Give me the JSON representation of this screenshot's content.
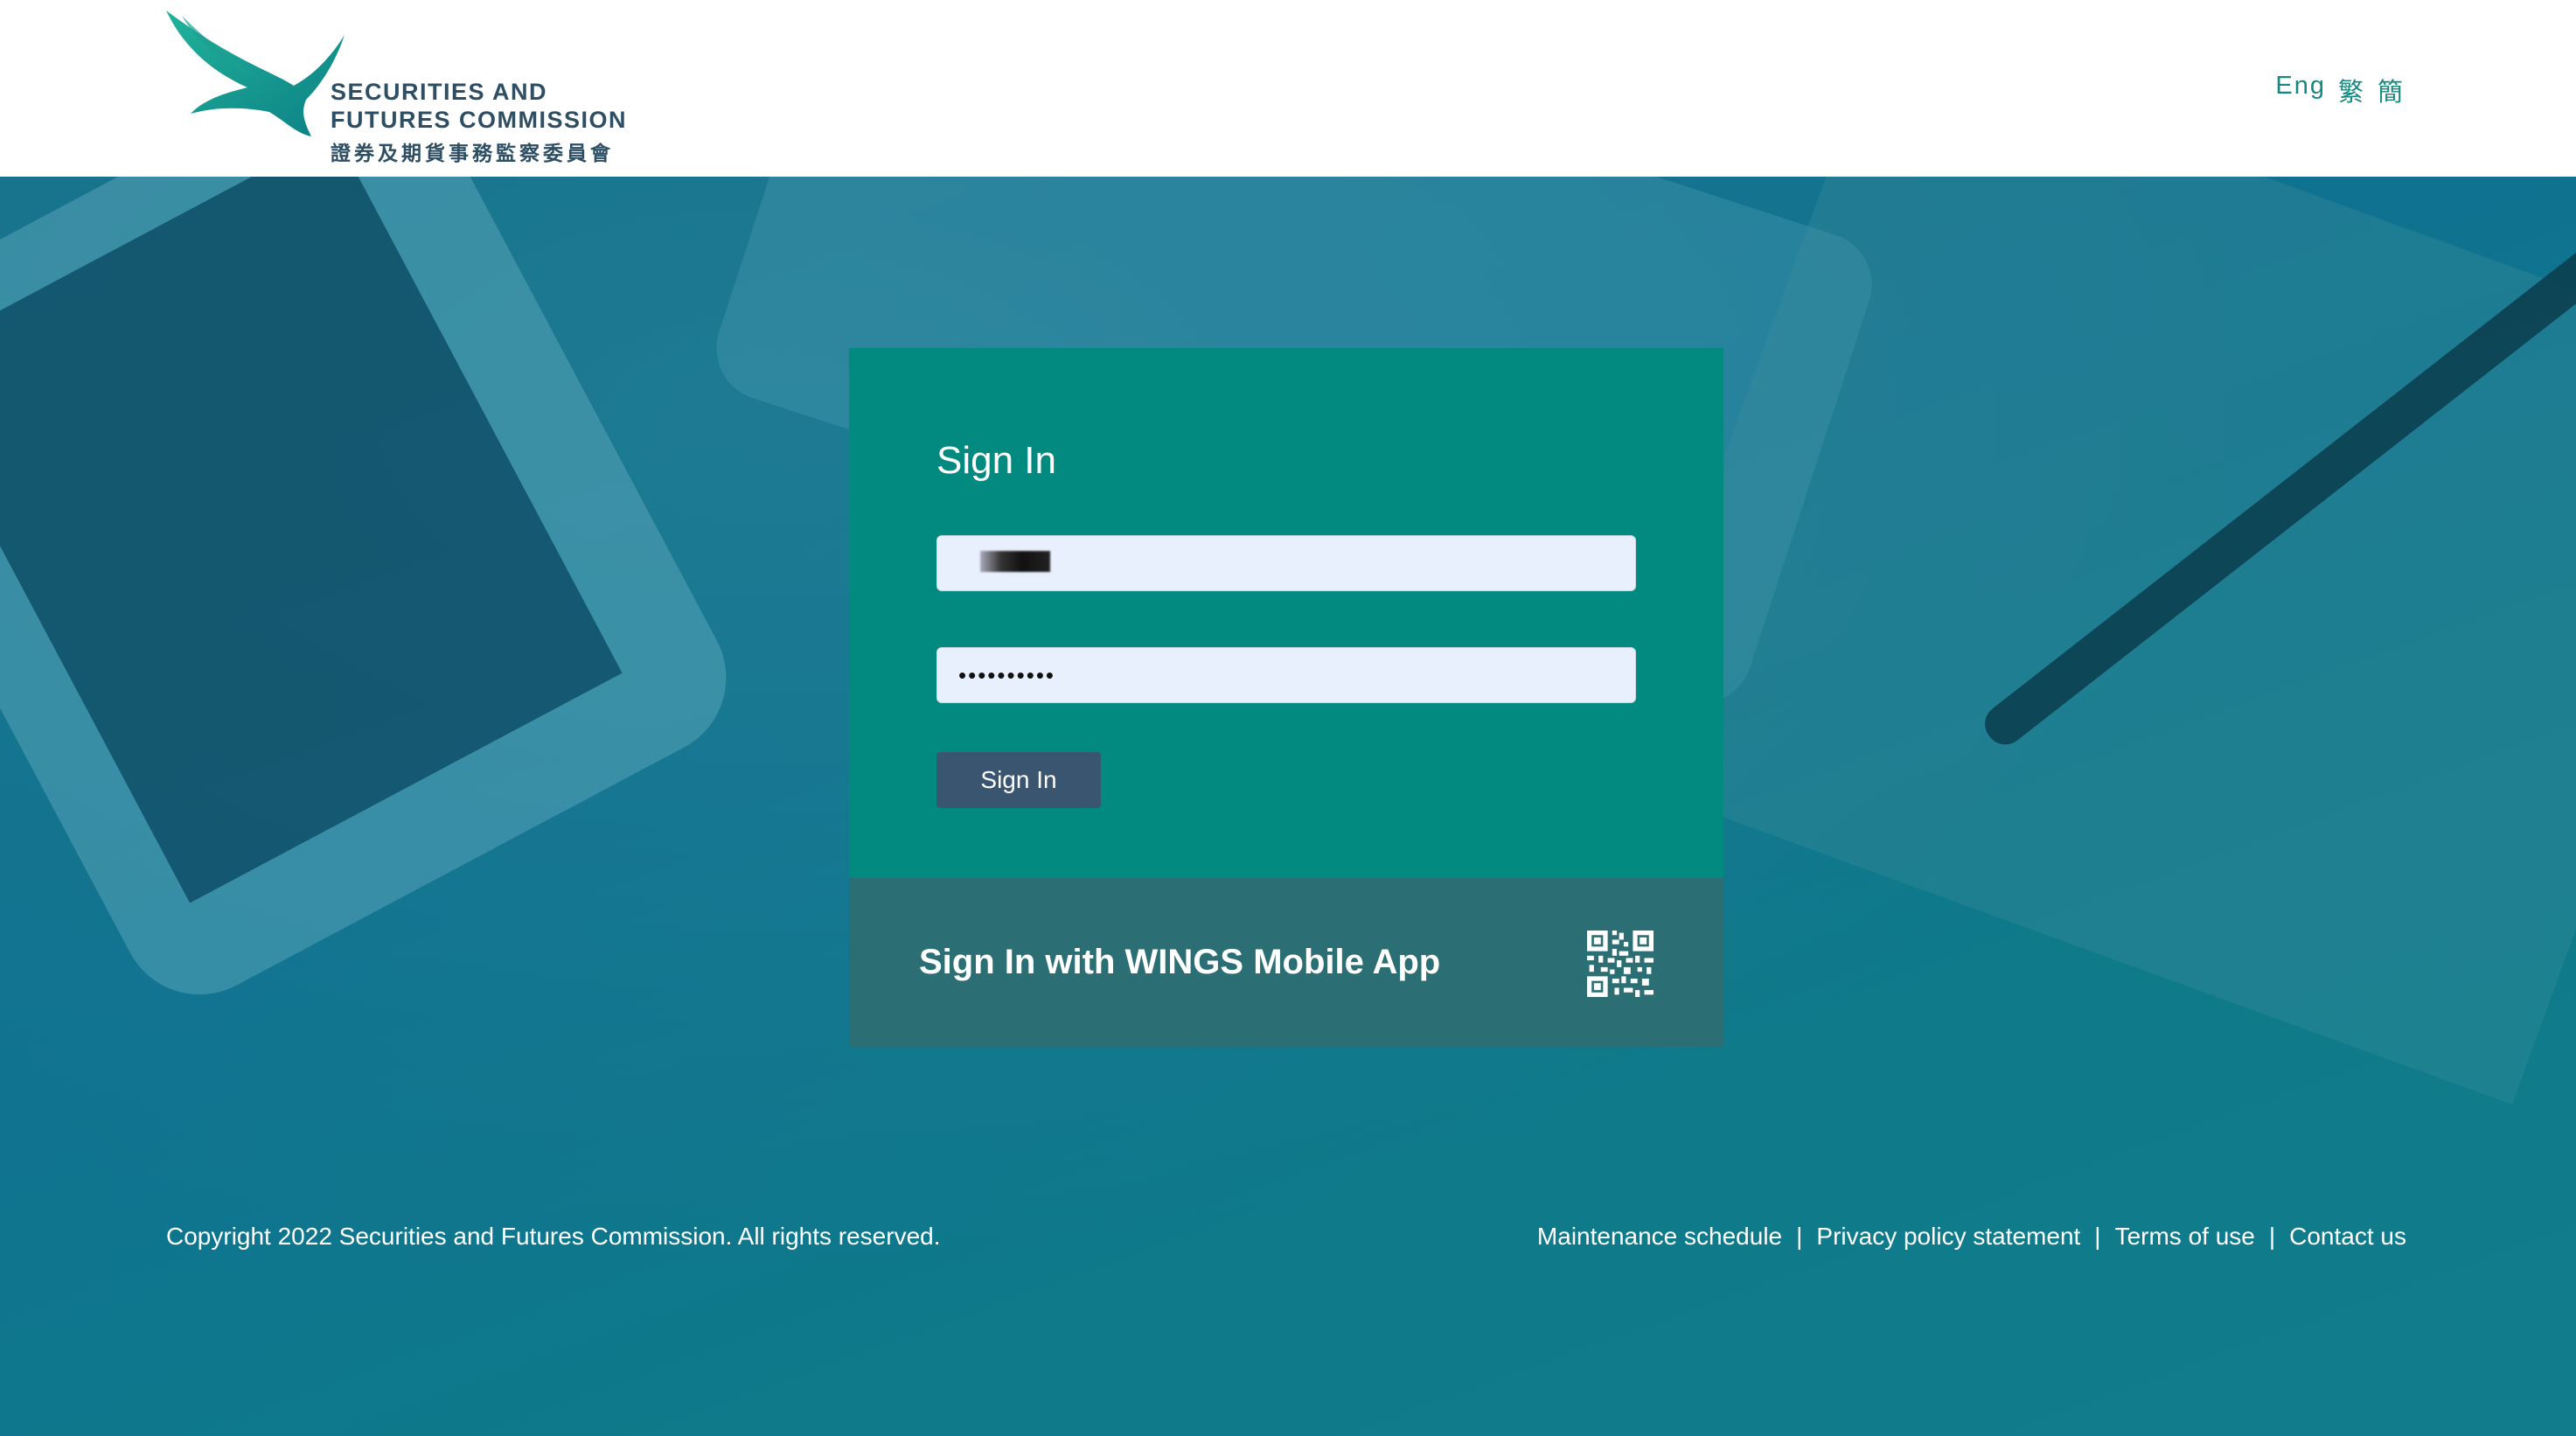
{
  "header": {
    "logo": {
      "name_line1": "SECURITIES AND",
      "name_line2": "FUTURES COMMISSION",
      "name_cn": "證券及期貨事務監察委員會"
    },
    "languages": [
      "Eng",
      "繁",
      "簡"
    ]
  },
  "login": {
    "title": "Sign In",
    "username_value": "",
    "password_value": "••••••••••",
    "submit_label": "Sign In"
  },
  "wings": {
    "label": "Sign In with WINGS Mobile App",
    "icon": "qr-code-icon"
  },
  "footer": {
    "copyright": "Copyright 2022 Securities and Futures Commission. All rights reserved.",
    "links": [
      "Maintenance schedule",
      "Privacy policy statement",
      "Terms of use",
      "Contact us"
    ],
    "separator": "|"
  },
  "colors": {
    "brand_teal": "#038a80",
    "wings_panel": "#2b6e73",
    "button": "#3a5570",
    "logo_text": "#2d4e63"
  }
}
